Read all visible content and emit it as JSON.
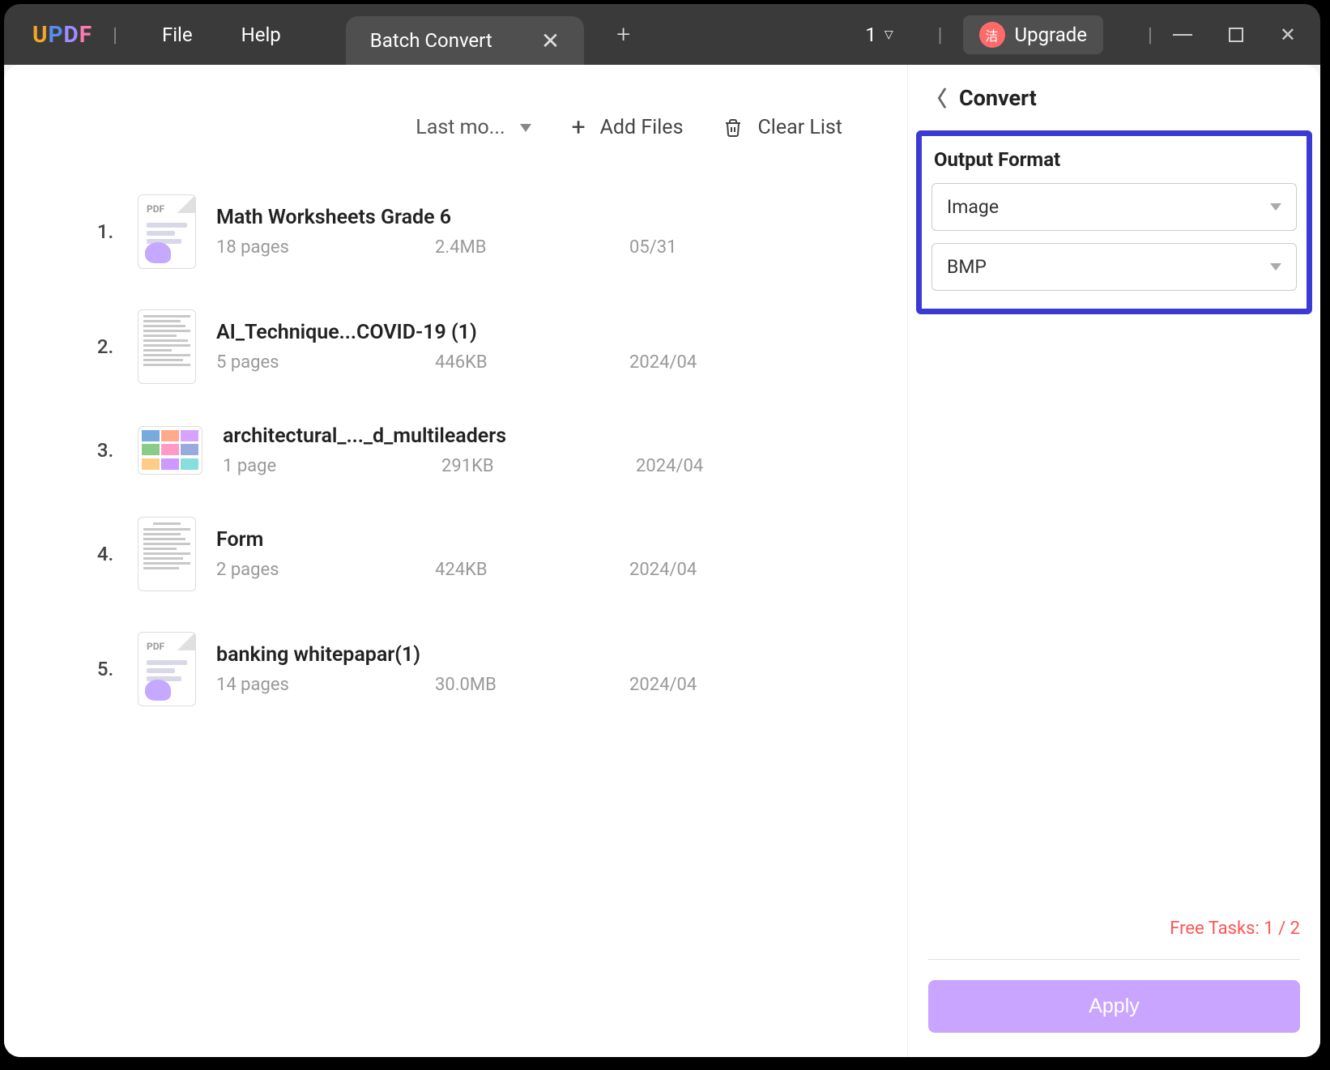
{
  "menu": {
    "file": "File",
    "help": "Help"
  },
  "tab": {
    "title": "Batch Convert",
    "counter": "1"
  },
  "upgrade": {
    "avatar": "洁",
    "label": "Upgrade"
  },
  "toolbar": {
    "sort": "Last mo...",
    "add": "Add Files",
    "clear": "Clear List"
  },
  "files": [
    {
      "idx": "1.",
      "name": "Math Worksheets Grade 6",
      "pages": "18 pages",
      "size": "2.4MB",
      "date": "05/31",
      "thumb": "pdf"
    },
    {
      "idx": "2.",
      "name": "AI_Technique...COVID-19 (1)",
      "pages": "5 pages",
      "size": "446KB",
      "date": "2024/04",
      "thumb": "doc"
    },
    {
      "idx": "3.",
      "name": "architectural_..._d_multileaders",
      "pages": "1 page",
      "size": "291KB",
      "date": "2024/04",
      "thumb": "wide"
    },
    {
      "idx": "4.",
      "name": "Form",
      "pages": "2 pages",
      "size": "424KB",
      "date": "2024/04",
      "thumb": "doc"
    },
    {
      "idx": "5.",
      "name": "banking whitepapar(1)",
      "pages": "14 pages",
      "size": "30.0MB",
      "date": "2024/04",
      "thumb": "pdf"
    }
  ],
  "side": {
    "title": "Convert",
    "outputFormat": "Output Format",
    "formatType": "Image",
    "formatSub": "BMP",
    "freeTasks": "Free Tasks: 1 / 2",
    "apply": "Apply"
  }
}
